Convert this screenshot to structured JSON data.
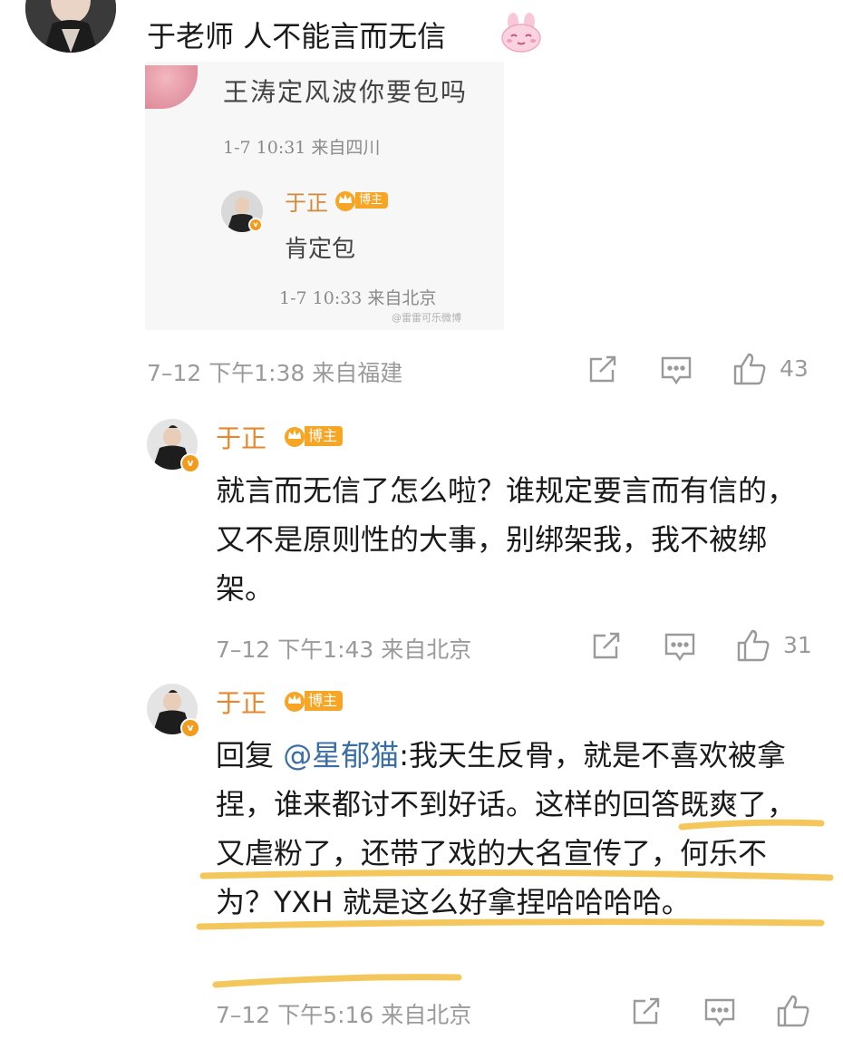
{
  "header": {
    "comment_text": "于老师 人不能言而无信",
    "emoji": "bunny-face-emoji"
  },
  "quoted_screenshot": {
    "question": "王涛定风波你要包吗",
    "question_meta": "1-7 10:31 来自四川",
    "reply_name": "于正",
    "reply_badge": "博主",
    "reply_text": "肯定包",
    "reply_meta": "1-7 10:33 来自北京",
    "watermark": "@雷雷可乐",
    "watermark_suffix": "微博"
  },
  "comments": [
    {
      "meta": "7–12 下午1:38 来自福建",
      "likes": "43"
    },
    {
      "name": "于正",
      "badge": "博主",
      "text": "就言而无信了怎么啦？谁规定要言而有信的，又不是原则性的大事，别绑架我，我不被绑架。",
      "meta": "7–12 下午1:43 来自北京",
      "likes": "31"
    },
    {
      "name": "于正",
      "badge": "博主",
      "reply_prefix": "回复",
      "mention": "@星郁猫",
      "text": ":我天生反骨，就是不喜欢被拿捏，谁来都讨不到好话。这样的回答既爽了，又虐粉了，还带了戏的大名宣传了，何乐不为？YXH 就是这么好拿捏哈哈哈哈。",
      "meta": "7–12 下午5:16 来自北京",
      "likes": ""
    }
  ],
  "colors": {
    "name": "#e8862a",
    "badge": "#f6a524",
    "mention": "#3a6ea5",
    "meta": "#9a9a9a",
    "highlight": "#f3c14b"
  }
}
